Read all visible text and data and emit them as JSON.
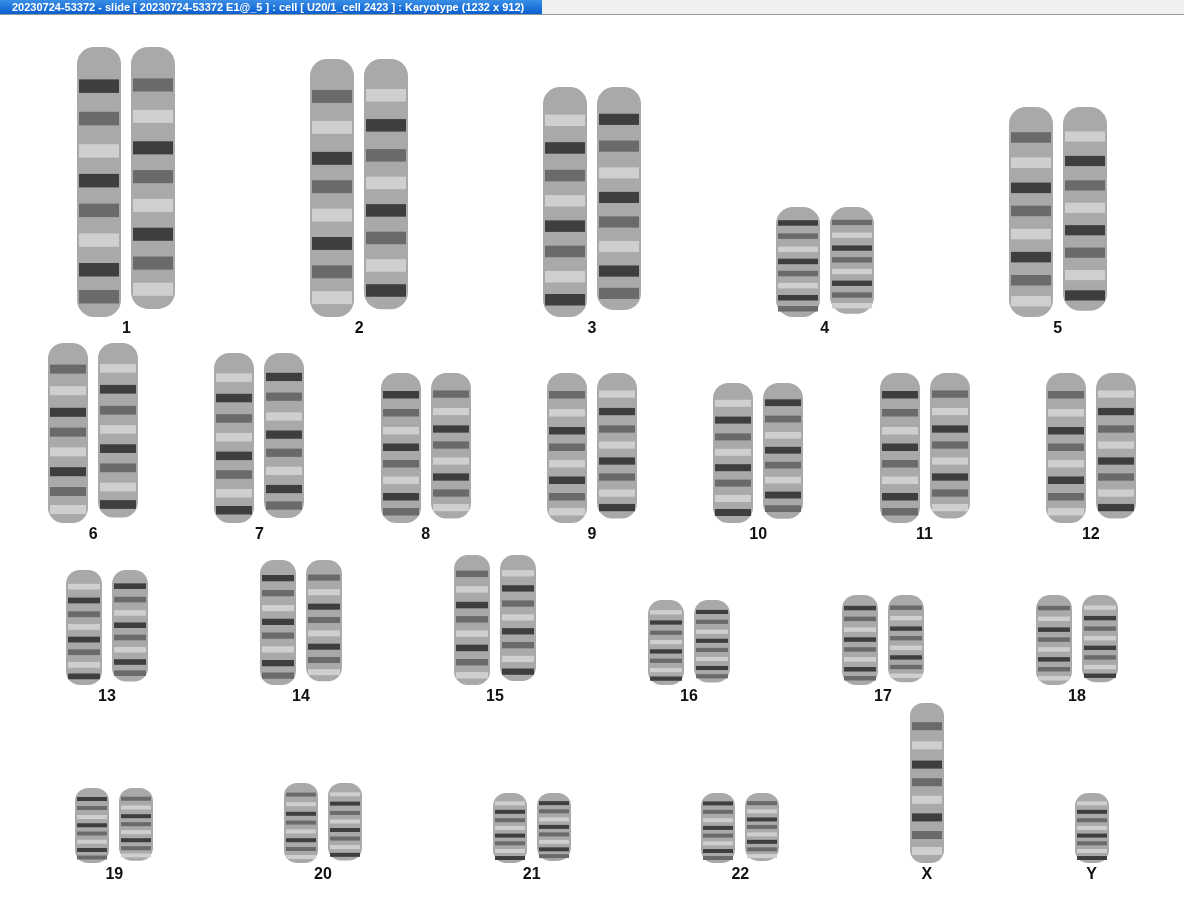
{
  "window": {
    "title": "20230724-53372 - slide [ 20230724-53372 E1@_5 ] : cell [ U20/1_cell 2423 ] : Karyotype  (1232 x 912)"
  },
  "rows": [
    {
      "chromosomes": [
        {
          "label": "1",
          "kind": "pair"
        },
        {
          "label": "2",
          "kind": "pair"
        },
        {
          "label": "3",
          "kind": "pair"
        },
        {
          "label": "4",
          "kind": "pair"
        },
        {
          "label": "5",
          "kind": "pair"
        }
      ]
    },
    {
      "chromosomes": [
        {
          "label": "6",
          "kind": "pair"
        },
        {
          "label": "7",
          "kind": "pair"
        },
        {
          "label": "8",
          "kind": "pair"
        },
        {
          "label": "9",
          "kind": "pair"
        },
        {
          "label": "10",
          "kind": "pair"
        },
        {
          "label": "11",
          "kind": "pair"
        },
        {
          "label": "12",
          "kind": "pair"
        }
      ]
    },
    {
      "chromosomes": [
        {
          "label": "13",
          "kind": "pair"
        },
        {
          "label": "14",
          "kind": "pair"
        },
        {
          "label": "15",
          "kind": "pair"
        },
        {
          "label": "16",
          "kind": "pair"
        },
        {
          "label": "17",
          "kind": "pair"
        },
        {
          "label": "18",
          "kind": "pair"
        }
      ]
    },
    {
      "chromosomes": [
        {
          "label": "19",
          "kind": "pair"
        },
        {
          "label": "20",
          "kind": "pair"
        },
        {
          "label": "21",
          "kind": "pair"
        },
        {
          "label": "22",
          "kind": "pair"
        },
        {
          "label": "X",
          "kind": "single"
        },
        {
          "label": "Y",
          "kind": "single"
        }
      ]
    }
  ]
}
